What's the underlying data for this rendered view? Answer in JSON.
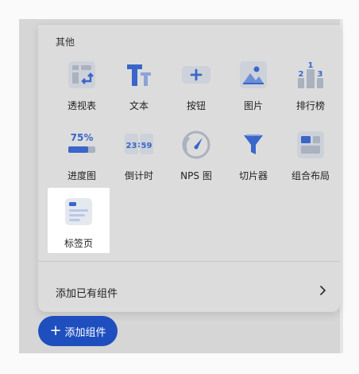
{
  "panel": {
    "section_title": "其他",
    "items": [
      {
        "label": "透视表",
        "icon": "pivot-table-icon"
      },
      {
        "label": "文本",
        "icon": "text-icon"
      },
      {
        "label": "按钮",
        "icon": "button-icon"
      },
      {
        "label": "图片",
        "icon": "image-icon"
      },
      {
        "label": "排行榜",
        "icon": "leaderboard-icon"
      },
      {
        "label": "进度图",
        "icon": "progress-icon",
        "icon_text": "75%"
      },
      {
        "label": "倒计时",
        "icon": "countdown-icon",
        "icon_text_left": "23",
        "icon_text_right": "59"
      },
      {
        "label": "NPS 图",
        "icon": "nps-gauge-icon"
      },
      {
        "label": "切片器",
        "icon": "slicer-funnel-icon"
      },
      {
        "label": "组合布局",
        "icon": "combo-layout-icon"
      },
      {
        "label": "标签页",
        "icon": "tab-page-icon"
      }
    ],
    "leaderboard_digits": [
      "1",
      "2",
      "3"
    ],
    "add_existing_label": "添加已有组件"
  },
  "add_button": {
    "label": "添加组件"
  },
  "colors": {
    "accent": "#1f4fbf",
    "icon_blue": "#3a66c9",
    "icon_bg": "#cfd3db",
    "panel_bg": "#dcdcdc"
  }
}
